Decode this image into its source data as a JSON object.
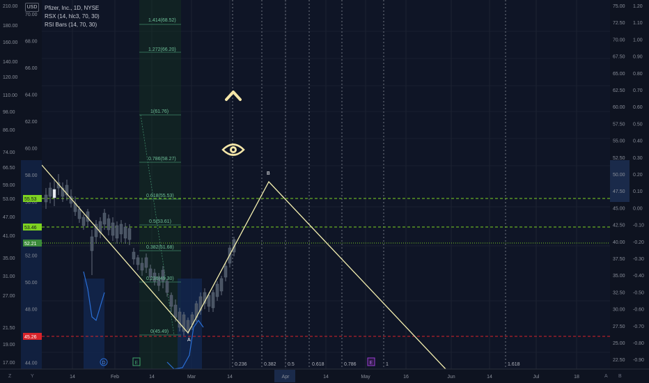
{
  "legend": {
    "title": "Pfizer, Inc., 1D, NYSE",
    "rsx": "RSX (14, hlc3, 70, 30)",
    "rsi_bars": "RSI Bars (14, 70, 30)"
  },
  "currency": "USD",
  "left_scale_outer": [
    "210.00",
    "180.00",
    "160.00",
    "140.00",
    "120.00",
    "110.00",
    "98.00",
    "86.00",
    "74.00",
    "66.50",
    "59.00",
    "53.00",
    "47.00",
    "41.00",
    "35.00",
    "31.00",
    "27.00",
    "21.50",
    "19.00",
    "17.00"
  ],
  "left_scale_inner": [
    "70.00",
    "68.00",
    "66.00",
    "64.00",
    "62.00",
    "60.00",
    "58.00",
    "56.00",
    "54.00",
    "52.00",
    "50.00",
    "48.00",
    "46.00",
    "44.00"
  ],
  "price_tags": [
    {
      "label": "55.53",
      "color": "#7ed321"
    },
    {
      "label": "53.46",
      "color": "#7ed321"
    },
    {
      "label": "52.21",
      "color": "#3a8a3a"
    },
    {
      "label": "45.26",
      "color": "#d9242b"
    }
  ],
  "right_scale_price": [
    "75.00",
    "72.50",
    "70.00",
    "67.50",
    "65.00",
    "62.50",
    "60.00",
    "57.50",
    "55.00",
    "52.50",
    "50.00",
    "47.50",
    "45.00",
    "42.50",
    "40.00",
    "37.50",
    "35.00",
    "32.50",
    "30.00",
    "27.50",
    "25.00",
    "22.50"
  ],
  "right_scale_osc": [
    "1.20",
    "1.10",
    "1.00",
    "0.90",
    "0.80",
    "0.70",
    "0.60",
    "0.50",
    "0.40",
    "0.30",
    "0.20",
    "0.10",
    "0.00",
    "-0.10",
    "-0.20",
    "-0.30",
    "-0.40",
    "-0.50",
    "-0.60",
    "-0.70",
    "-0.80",
    "-0.90"
  ],
  "time_axis": [
    "14",
    "Feb",
    "14",
    "Mar",
    "14",
    "Apr",
    "14",
    "May",
    "16",
    "Jun",
    "14",
    "Jul",
    "18"
  ],
  "fib_levels": [
    "1.414(68.52)",
    "1.272(66.20)",
    "1(61.76)",
    "0.786(58.27)",
    "0.618(55.53)",
    "0.5(53.61)",
    "0.382(51.68)",
    "0.236(49.30)",
    "0(45.49)"
  ],
  "fib_time_labels": [
    "0.236",
    "0.382",
    "0.5",
    "0.618",
    "0.786",
    "1",
    "1.618"
  ],
  "wave_labels": [
    "A",
    "B"
  ],
  "event_markers": [
    "D",
    "E",
    "E"
  ],
  "bottom_buttons": [
    "Z",
    "Y",
    "A",
    "B"
  ],
  "colors": {
    "background": "#0e1320",
    "zigzag": "#f5f0b0",
    "fib": "#4caf8f",
    "green_line": "#7ed321",
    "red_line": "#d9242b",
    "rsx": "#2a6fd6",
    "accent": "#f5e6a8"
  },
  "icons": [
    "chevron-up-icon",
    "eye-icon"
  ]
}
